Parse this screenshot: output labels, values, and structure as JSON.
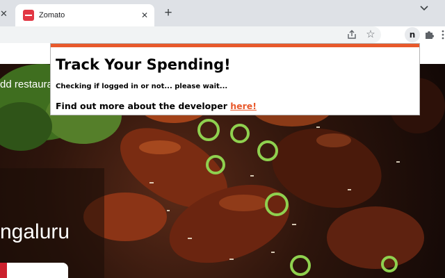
{
  "browser": {
    "tab": {
      "title": "Zomato",
      "close_glyph": "✕"
    },
    "prev_tab_close_glyph": "✕",
    "new_tab_glyph": "+",
    "toolbar": {
      "share_icon": "share-icon",
      "bookmark_icon": "star-icon",
      "bookmark_glyph": "☆",
      "extension_letter": "n",
      "extensions_icon": "puzzle-icon",
      "menu_icon": "kebab-icon"
    }
  },
  "page": {
    "nav_text": "dd restaura",
    "city_text": "ngaluru"
  },
  "popup": {
    "title": "Track Your Spending!",
    "status": "Checking if logged in or not... please wait...",
    "developer_prefix": "Find out more about the developer ",
    "developer_link": "here!"
  },
  "colors": {
    "popup_accent": "#e8592b",
    "link": "#e8592b",
    "favicon": "#e23744",
    "tabstrip": "#dee1e6"
  }
}
